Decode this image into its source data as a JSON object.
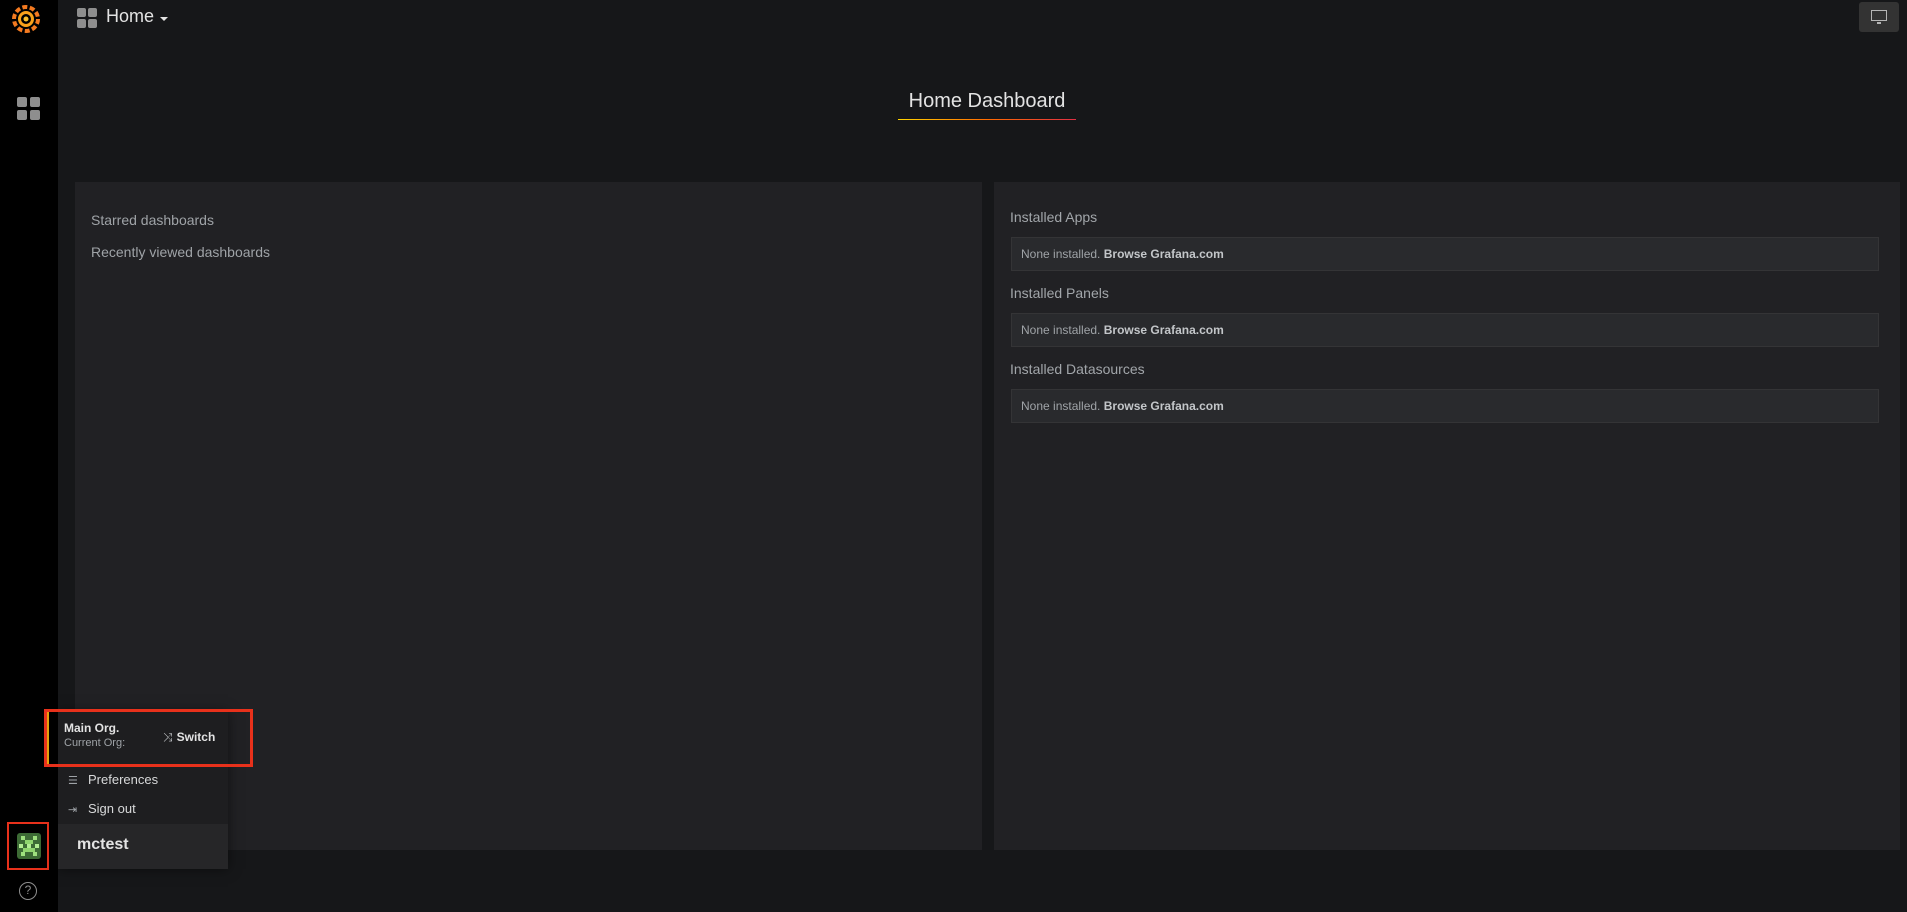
{
  "topbar": {
    "title": "Home"
  },
  "main": {
    "dashboard_title": "Home Dashboard",
    "left_panel": {
      "starred": "Starred dashboards",
      "recent": "Recently viewed dashboards"
    },
    "right_panel": {
      "sections": [
        {
          "heading": "Installed Apps",
          "none_text": "None installed.",
          "link": "Browse Grafana.com"
        },
        {
          "heading": "Installed Panels",
          "none_text": "None installed.",
          "link": "Browse Grafana.com"
        },
        {
          "heading": "Installed Datasources",
          "none_text": "None installed.",
          "link": "Browse Grafana.com"
        }
      ]
    }
  },
  "user_menu": {
    "org_name": "Main Org.",
    "org_sub": "Current Org:",
    "switch_label": "Switch",
    "preferences_label": "Preferences",
    "signout_label": "Sign out",
    "username": "mctest"
  },
  "sidemenu": {
    "help_glyph": "?"
  },
  "colors": {
    "background": "#161719",
    "panel": "#212124",
    "sidemenu": "#000000",
    "highlight_box": "#e8311b",
    "org_accent": "#e8a10d"
  },
  "icons": [
    "grafana-logo-icon",
    "dashboards-grid-icon",
    "user-avatar-icon",
    "help-icon",
    "tv-mode-icon",
    "switch-shuffle-icon",
    "preferences-sliders-icon",
    "sign-out-icon"
  ]
}
